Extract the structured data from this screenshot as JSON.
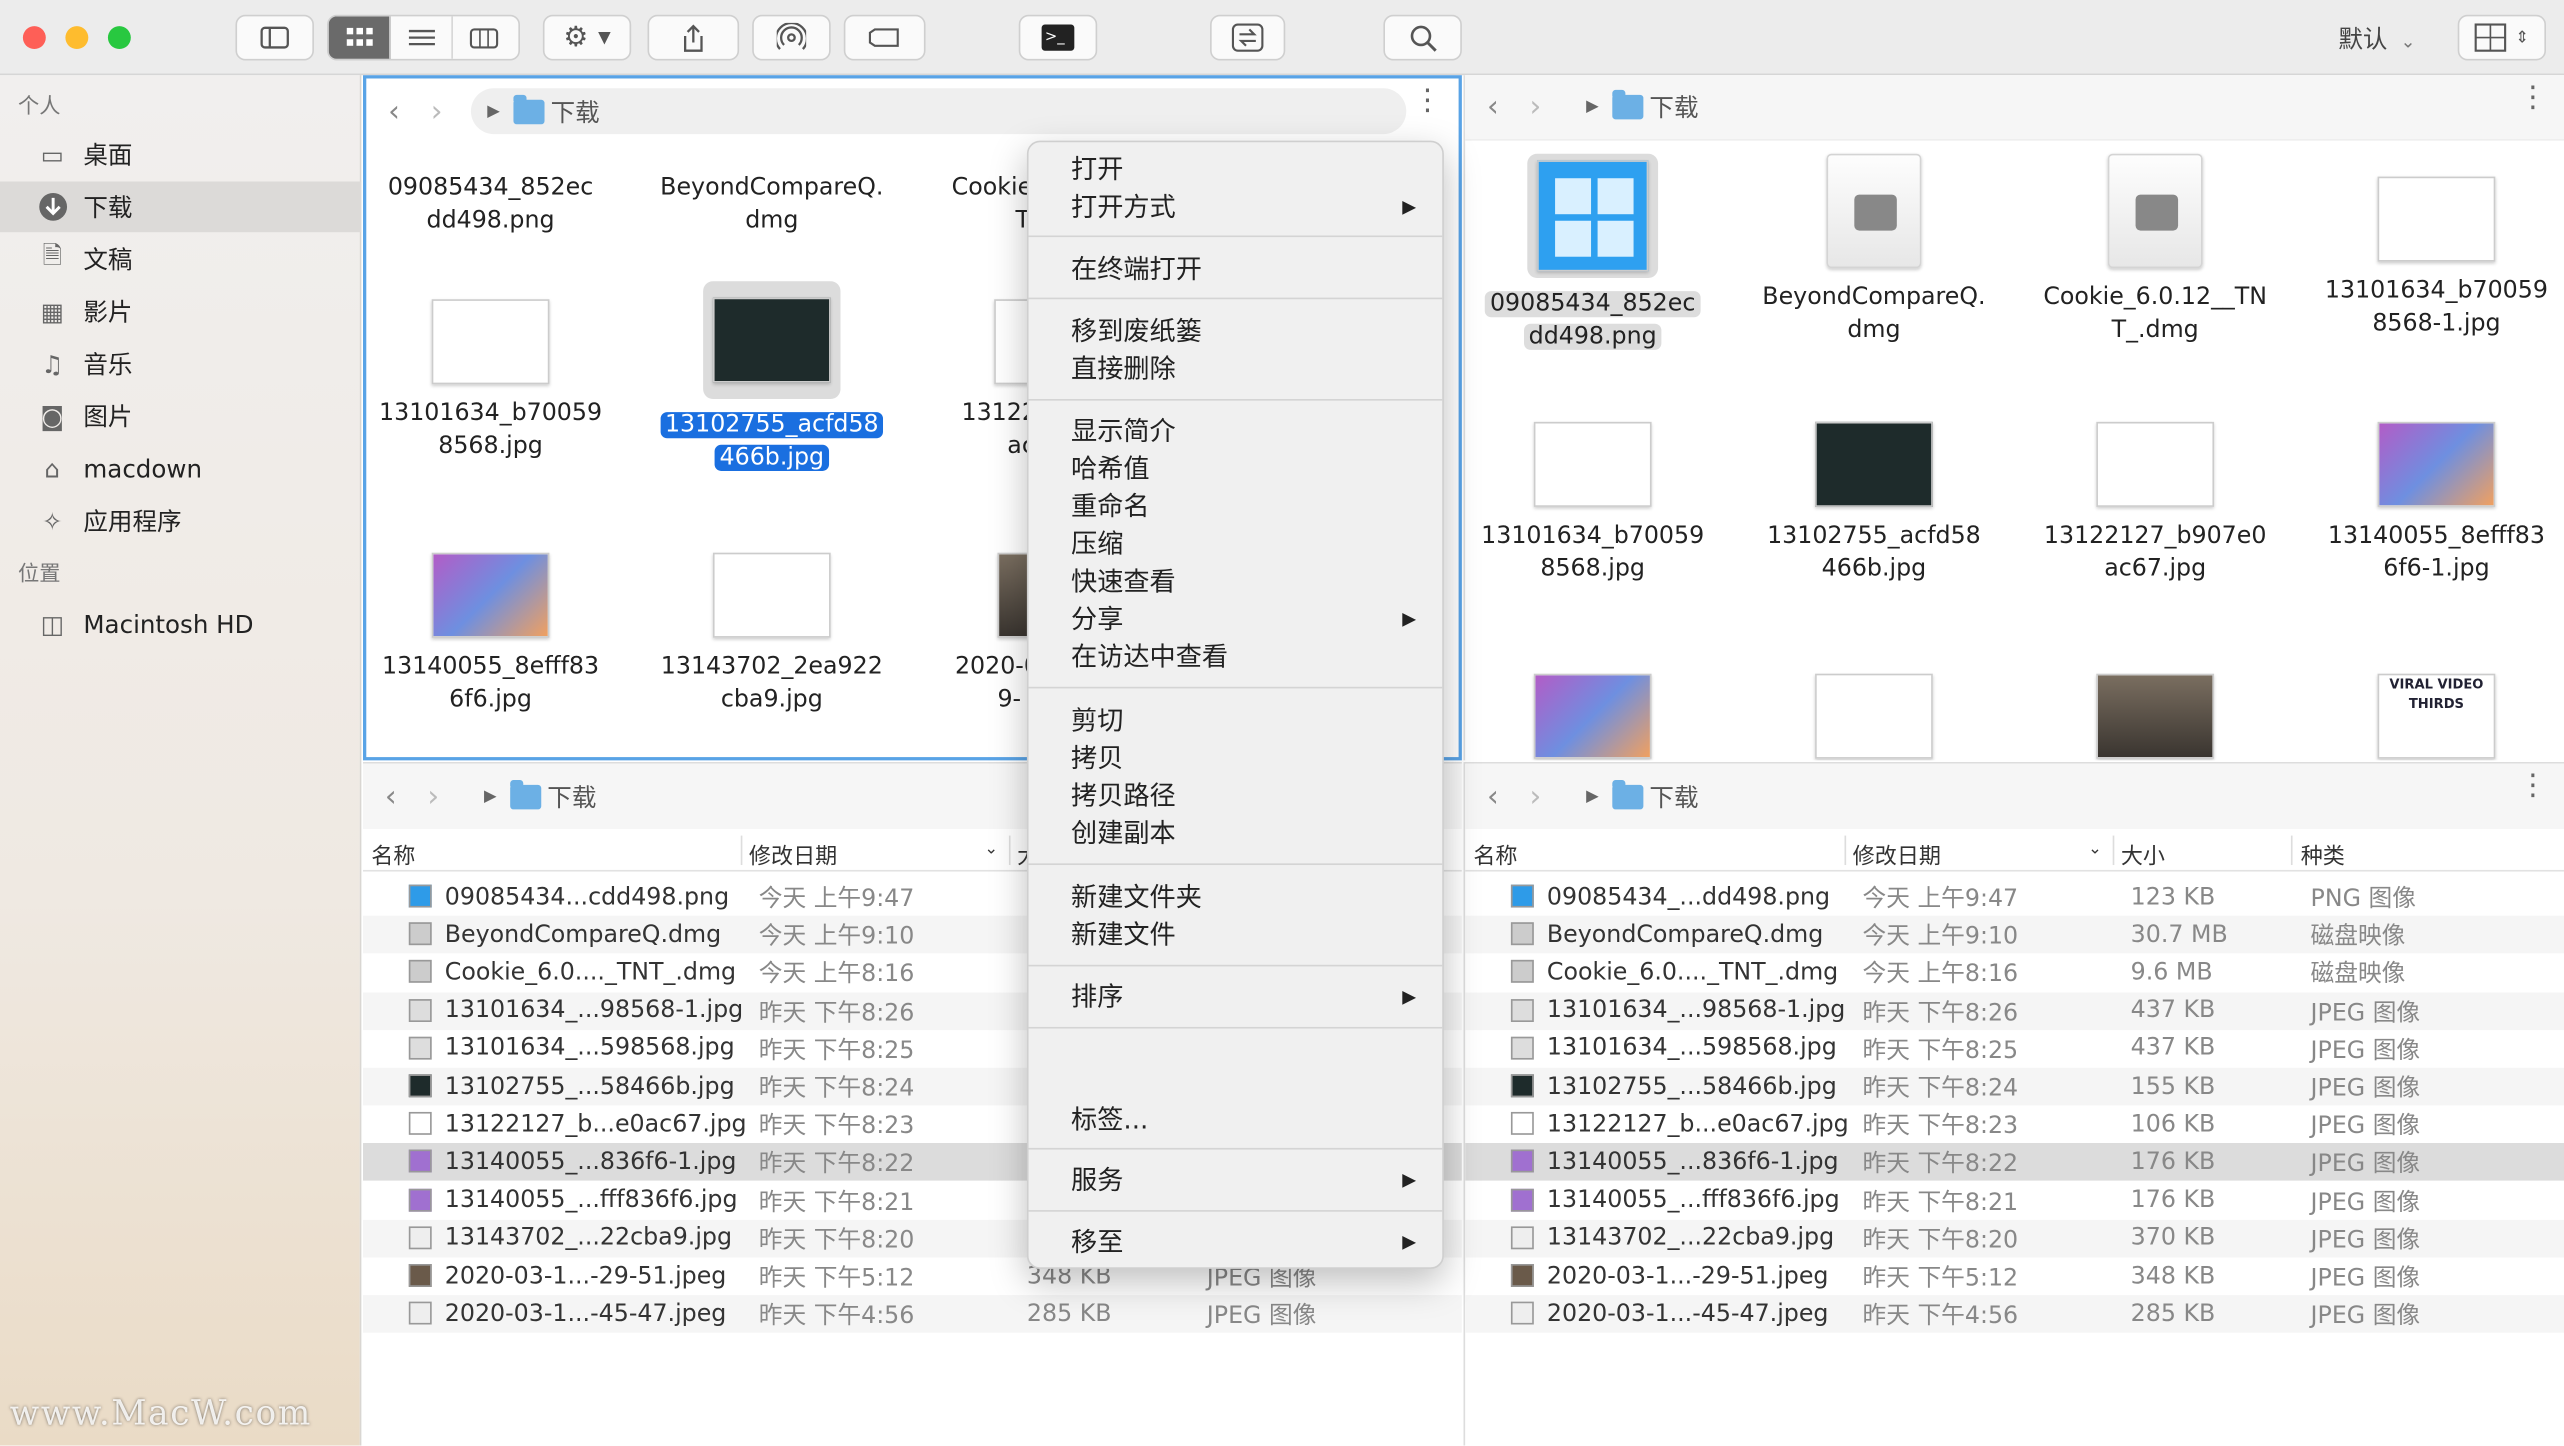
{
  "toolbar": {
    "lang_label": "默认",
    "traffic_colors": {
      "close": "#fe5f57",
      "minimize": "#febc2e",
      "zoom": "#28c840"
    }
  },
  "sidebar": {
    "section_personal": "个人",
    "section_locations": "位置",
    "items": [
      {
        "label": "桌面",
        "icon": "desktop-icon"
      },
      {
        "label": "下载",
        "icon": "download-icon"
      },
      {
        "label": "文稿",
        "icon": "document-icon"
      },
      {
        "label": "影片",
        "icon": "film-icon"
      },
      {
        "label": "音乐",
        "icon": "music-icon"
      },
      {
        "label": "图片",
        "icon": "camera-icon"
      },
      {
        "label": "macdown",
        "icon": "home-icon"
      },
      {
        "label": "应用程序",
        "icon": "apps-icon"
      }
    ],
    "locations": [
      {
        "label": "Macintosh HD",
        "icon": "disk-icon"
      }
    ]
  },
  "folder_name": "下载",
  "pane_tl": {
    "row0": [
      "09085434_852ec",
      "dd498.png",
      "BeyondCompareQ.",
      "dmg",
      "Cookie",
      "T"
    ],
    "row1": [
      "13101634_b70059",
      "8568.jpg",
      "13102755_acfd58",
      "466b.jpg",
      "13122",
      "ac"
    ],
    "row2": [
      "13140055_8efff83",
      "6f6.jpg",
      "13143702_2ea922",
      "cba9.jpg",
      "2020-0",
      "9-"
    ]
  },
  "pane_tr": {
    "row0": [
      "09085434_852ec",
      "dd498.png",
      "BeyondCompareQ.",
      "dmg",
      "Cookie_6.0.12__TN",
      "T_.dmg",
      "13101634_b70059",
      "8568-1.jpg"
    ],
    "row1": [
      "13101634_b70059",
      "8568.jpg",
      "13102755_acfd58",
      "466b.jpg",
      "13122127_b907e0",
      "ac67.jpg",
      "13140055_8efff83",
      "6f6-1.jpg"
    ],
    "row2_thumb_text": "VIRAL VIDEO THIRDS"
  },
  "list": {
    "headers": {
      "name": "名称",
      "date": "修改日期",
      "size": "大小",
      "kind": "种类",
      "size_short": "大"
    },
    "rows": [
      {
        "name_l": "09085434...cdd498.png",
        "name_r": "09085434_...dd498.png",
        "date": "今天 上午9:47",
        "size": "123 KB",
        "kind": "PNG 图像"
      },
      {
        "name_l": "BeyondCompareQ.dmg",
        "name_r": "BeyondCompareQ.dmg",
        "date": "今天 上午9:10",
        "size": "30.7 MB",
        "kind": "磁盘映像"
      },
      {
        "name_l": "Cookie_6.0...._TNT_.dmg",
        "name_r": "Cookie_6.0...._TNT_.dmg",
        "date": "今天 上午8:16",
        "size": "9.6 MB",
        "kind": "磁盘映像"
      },
      {
        "name_l": "13101634_...98568-1.jpg",
        "name_r": "13101634_...98568-1.jpg",
        "date": "昨天 下午8:26",
        "size": "437 KB",
        "kind": "JPEG 图像"
      },
      {
        "name_l": "13101634_...598568.jpg",
        "name_r": "13101634_...598568.jpg",
        "date": "昨天 下午8:25",
        "size": "437 KB",
        "kind": "JPEG 图像"
      },
      {
        "name_l": "13102755_...58466b.jpg",
        "name_r": "13102755_...58466b.jpg",
        "date": "昨天 下午8:24",
        "size": "155 KB",
        "kind": "JPEG 图像"
      },
      {
        "name_l": "13122127_b...e0ac67.jpg",
        "name_r": "13122127_b...e0ac67.jpg",
        "date": "昨天 下午8:23",
        "size": "106 KB",
        "kind": "JPEG 图像"
      },
      {
        "name_l": "13140055_...836f6-1.jpg",
        "name_r": "13140055_...836f6-1.jpg",
        "date": "昨天 下午8:22",
        "size": "176 KB",
        "kind": "JPEG 图像"
      },
      {
        "name_l": "13140055_...fff836f6.jpg",
        "name_r": "13140055_...fff836f6.jpg",
        "date": "昨天 下午8:21",
        "size": "176 KB",
        "kind": "JPEG 图像"
      },
      {
        "name_l": "13143702_...22cba9.jpg",
        "name_r": "13143702_...22cba9.jpg",
        "date": "昨天 下午8:20",
        "size": "370 KB",
        "kind": "JPEG 图像"
      },
      {
        "name_l": "2020-03-1...-29-51.jpeg",
        "name_r": "2020-03-1...-29-51.jpeg",
        "date": "昨天 下午5:12",
        "size": "348 KB",
        "kind": "JPEG 图像"
      },
      {
        "name_l": "2020-03-1...-45-47.jpeg",
        "name_r": "2020-03-1...-45-47.jpeg",
        "date": "昨天 下午4:56",
        "size": "285 KB",
        "kind": "JPEG 图像"
      }
    ]
  },
  "menu": {
    "items": [
      "打开",
      "打开方式",
      "在终端打开",
      "移到废纸篓",
      "直接删除",
      "显示简介",
      "哈希值",
      "重命名",
      "压缩",
      "快速查看",
      "分享",
      "在访达中查看",
      "剪切",
      "拷贝",
      "拷贝路径",
      "创建副本",
      "新建文件夹",
      "新建文件",
      "排序",
      "标签...",
      "服务",
      "移至"
    ]
  },
  "watermark": "www.MacW.com"
}
